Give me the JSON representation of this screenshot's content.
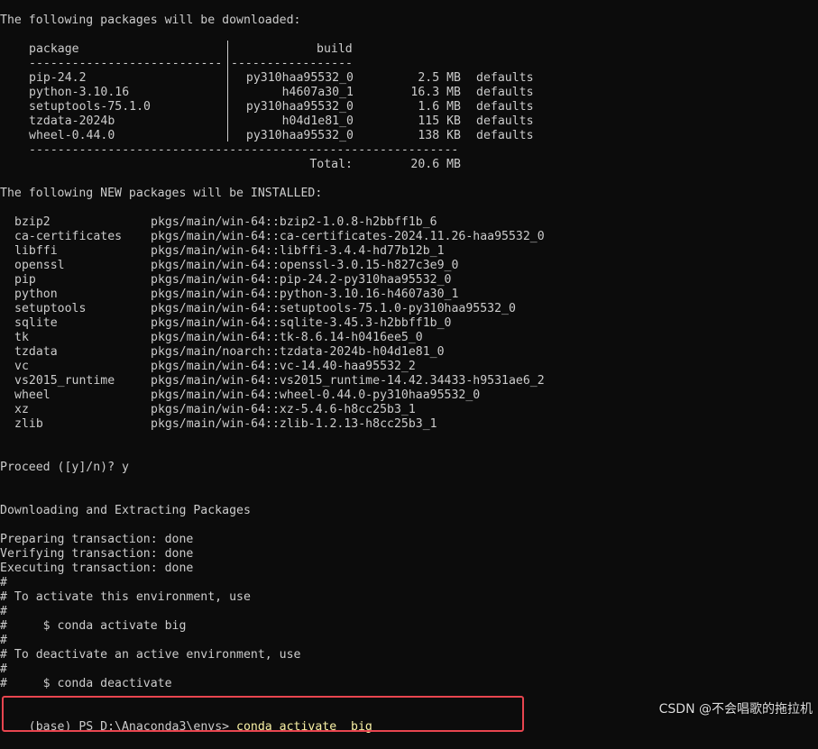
{
  "download_header": "The following packages will be downloaded:",
  "dl_table": {
    "col_package": "package",
    "col_build": "build",
    "sep_left": "---------------------------",
    "sep_right": "-----------------",
    "rows": [
      {
        "package": "pip-24.2",
        "build": "py310haa95532_0",
        "size": "2.5 MB",
        "channel": "defaults"
      },
      {
        "package": "python-3.10.16",
        "build": "h4607a30_1",
        "size": "16.3 MB",
        "channel": "defaults"
      },
      {
        "package": "setuptools-75.1.0",
        "build": "py310haa95532_0",
        "size": "1.6 MB",
        "channel": "defaults"
      },
      {
        "package": "tzdata-2024b",
        "build": "h04d1e81_0",
        "size": "115 KB",
        "channel": "defaults"
      },
      {
        "package": "wheel-0.44.0",
        "build": "py310haa95532_0",
        "size": "138 KB",
        "channel": "defaults"
      }
    ],
    "sep_total": "------------------------------------------------------------",
    "total_label": "Total:",
    "total_value": "20.6 MB"
  },
  "install_header": "The following NEW packages will be INSTALLED:",
  "installs": [
    {
      "name": "bzip2",
      "spec": "pkgs/main/win-64::bzip2-1.0.8-h2bbff1b_6"
    },
    {
      "name": "ca-certificates",
      "spec": "pkgs/main/win-64::ca-certificates-2024.11.26-haa95532_0"
    },
    {
      "name": "libffi",
      "spec": "pkgs/main/win-64::libffi-3.4.4-hd77b12b_1"
    },
    {
      "name": "openssl",
      "spec": "pkgs/main/win-64::openssl-3.0.15-h827c3e9_0"
    },
    {
      "name": "pip",
      "spec": "pkgs/main/win-64::pip-24.2-py310haa95532_0"
    },
    {
      "name": "python",
      "spec": "pkgs/main/win-64::python-3.10.16-h4607a30_1"
    },
    {
      "name": "setuptools",
      "spec": "pkgs/main/win-64::setuptools-75.1.0-py310haa95532_0"
    },
    {
      "name": "sqlite",
      "spec": "pkgs/main/win-64::sqlite-3.45.3-h2bbff1b_0"
    },
    {
      "name": "tk",
      "spec": "pkgs/main/win-64::tk-8.6.14-h0416ee5_0"
    },
    {
      "name": "tzdata",
      "spec": "pkgs/main/noarch::tzdata-2024b-h04d1e81_0"
    },
    {
      "name": "vc",
      "spec": "pkgs/main/win-64::vc-14.40-haa95532_2"
    },
    {
      "name": "vs2015_runtime",
      "spec": "pkgs/main/win-64::vs2015_runtime-14.42.34433-h9531ae6_2"
    },
    {
      "name": "wheel",
      "spec": "pkgs/main/win-64::wheel-0.44.0-py310haa95532_0"
    },
    {
      "name": "xz",
      "spec": "pkgs/main/win-64::xz-5.4.6-h8cc25b3_1"
    },
    {
      "name": "zlib",
      "spec": "pkgs/main/win-64::zlib-1.2.13-h8cc25b3_1"
    }
  ],
  "proceed": "Proceed ([y]/n)? y",
  "downloading": "Downloading and Extracting Packages",
  "transactions": [
    "Preparing transaction: done",
    "Verifying transaction: done",
    "Executing transaction: done"
  ],
  "hints": [
    "#",
    "# To activate this environment, use",
    "#",
    "#     $ conda activate big",
    "#",
    "# To deactivate an active environment, use",
    "#",
    "#     $ conda deactivate"
  ],
  "prompt": {
    "text": "(base) PS D:\\Anaconda3\\envs> ",
    "command": "conda activate  big",
    "highlight_color": "#e8454f"
  },
  "watermark": "CSDN @不会唱歌的拖拉机"
}
